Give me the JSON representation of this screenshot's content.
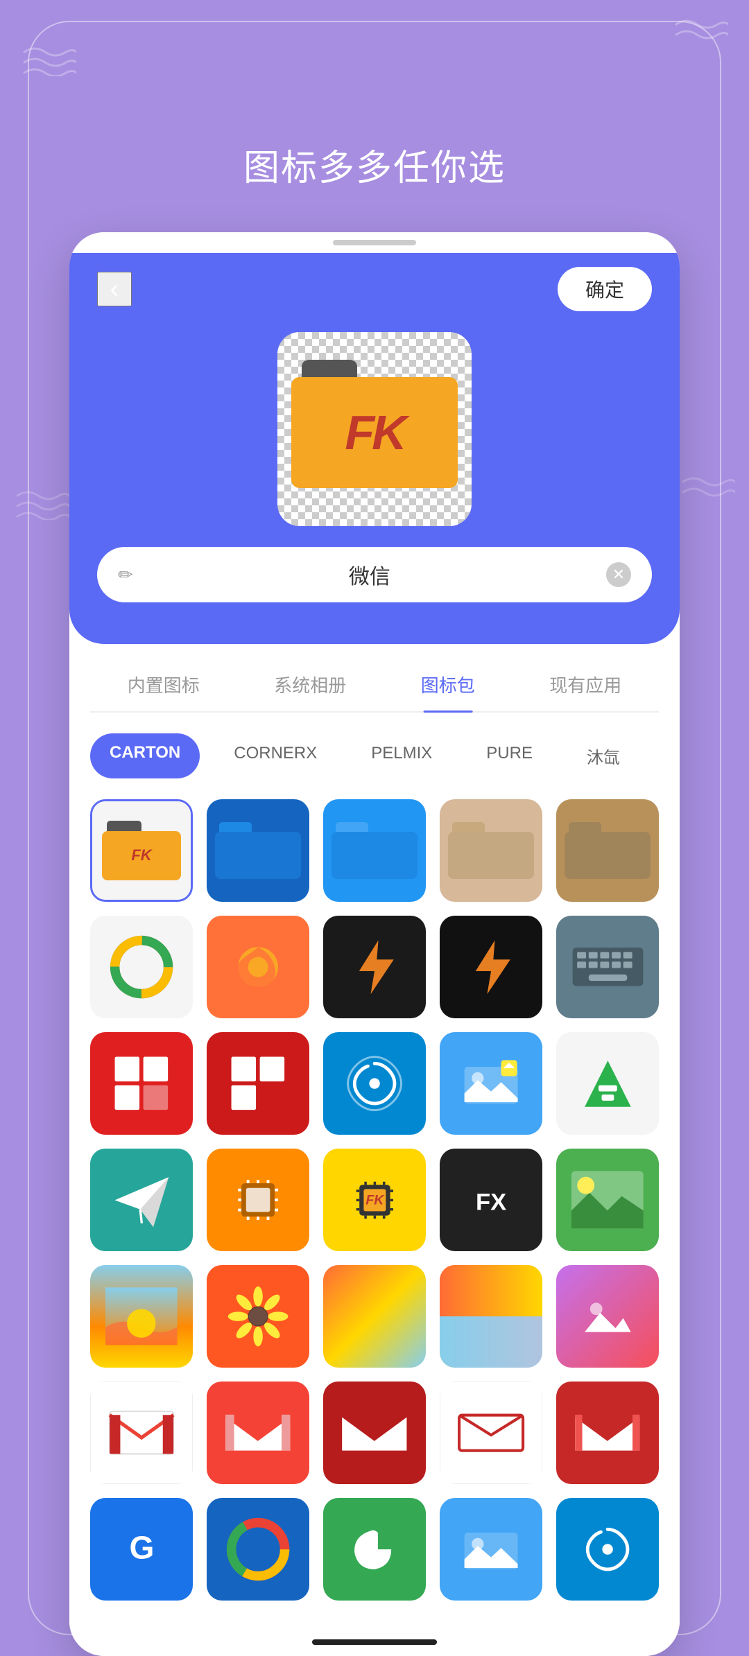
{
  "page": {
    "bg_color": "#a78ee0",
    "title": "图标多多任你选"
  },
  "phone": {
    "back_label": "‹",
    "confirm_label": "确定",
    "icon_name": "微信",
    "tabs": [
      {
        "id": "builtin",
        "label": "内置图标",
        "active": false
      },
      {
        "id": "album",
        "label": "系统相册",
        "active": false
      },
      {
        "id": "iconpack",
        "label": "图标包",
        "active": true
      },
      {
        "id": "current",
        "label": "现有应用",
        "active": false
      }
    ],
    "chips": [
      {
        "id": "carton",
        "label": "CARTON",
        "active": true
      },
      {
        "id": "cornerx",
        "label": "CORNERX",
        "active": false
      },
      {
        "id": "pelmix",
        "label": "PELMIX",
        "active": false
      },
      {
        "id": "pure",
        "label": "PURE",
        "active": false
      },
      {
        "id": "muxi",
        "label": "沐氙",
        "active": false
      }
    ],
    "icons": [
      {
        "id": "fk-folder",
        "type": "fk",
        "selected": true
      },
      {
        "id": "folder-dark-blue",
        "type": "folder-blue"
      },
      {
        "id": "folder-bright-blue",
        "type": "folder-bright-blue"
      },
      {
        "id": "folder-tan",
        "type": "folder-tan"
      },
      {
        "id": "folder-brown",
        "type": "folder-brown"
      },
      {
        "id": "google-ring",
        "type": "google-colors"
      },
      {
        "id": "firefox",
        "type": "firefox"
      },
      {
        "id": "lightning1",
        "type": "lightning-dark"
      },
      {
        "id": "lightning2",
        "type": "lightning-dark2"
      },
      {
        "id": "keyboard",
        "type": "keyboard"
      },
      {
        "id": "flipboard1",
        "type": "flipboard-red"
      },
      {
        "id": "flipboard2",
        "type": "flipboard-red2"
      },
      {
        "id": "swirl",
        "type": "swirl-blue"
      },
      {
        "id": "gallery",
        "type": "gallery-blue"
      },
      {
        "id": "feedly",
        "type": "feedly"
      },
      {
        "id": "paper",
        "type": "paper-teal"
      },
      {
        "id": "cpu1",
        "type": "cpu-gold"
      },
      {
        "id": "cpu2",
        "type": "cpu-yellow"
      },
      {
        "id": "fx",
        "type": "fx-dark"
      },
      {
        "id": "landscape",
        "type": "landscape"
      },
      {
        "id": "sunrise1",
        "type": "sunrise"
      },
      {
        "id": "sunflower",
        "type": "sunflower"
      },
      {
        "id": "gallery-sunset",
        "type": "gallery-sunset"
      },
      {
        "id": "photos",
        "type": "photos"
      },
      {
        "id": "gmail1",
        "type": "gmail-g"
      },
      {
        "id": "gmail2",
        "type": "gmail-red"
      },
      {
        "id": "gmail3",
        "type": "gmail-dark"
      },
      {
        "id": "gmail4",
        "type": "gmail-outline"
      },
      {
        "id": "gmail5",
        "type": "gmail-dark"
      },
      {
        "id": "google-row2-1",
        "type": "google-blue-bg"
      },
      {
        "id": "google-row2-2",
        "type": "chrome-blue"
      },
      {
        "id": "google-row2-3",
        "type": "google-green"
      },
      {
        "id": "google-row2-4",
        "type": "gallery-blue"
      },
      {
        "id": "google-row2-5",
        "type": "swirl-blue"
      }
    ]
  }
}
